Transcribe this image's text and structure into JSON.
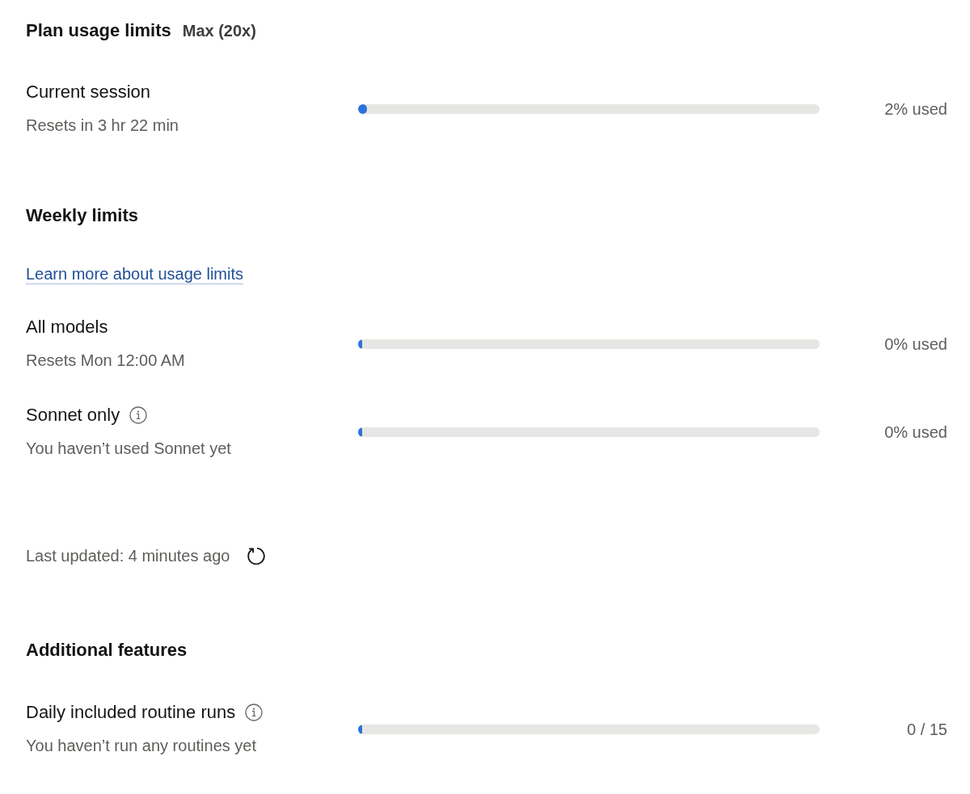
{
  "header": {
    "title": "Plan usage limits",
    "plan": "Max (20x)"
  },
  "current_session": {
    "label": "Current session",
    "info": false,
    "detail": "Resets in 3 hr 22 min",
    "level": 0.02,
    "reading": "2% used"
  },
  "weekly_limits": {
    "heading": "Weekly limits",
    "link": "Learn more about usage limits",
    "items": [
      {
        "label": "All models",
        "info": false,
        "detail": "Resets Mon 12:00 AM",
        "level": 0,
        "reading": "0% used"
      },
      {
        "label": "Sonnet only",
        "info": true,
        "detail": "You haven’t used Sonnet yet",
        "level": 0,
        "reading": "0% used"
      }
    ]
  },
  "last_updated": {
    "text": "Last updated: 4 minutes ago"
  },
  "additional_features": {
    "heading": "Additional features",
    "items": [
      {
        "label": "Daily included routine runs",
        "info": true,
        "detail": "You haven’t run any routines yet",
        "level": 0,
        "reading": "0 / 15"
      }
    ]
  }
}
